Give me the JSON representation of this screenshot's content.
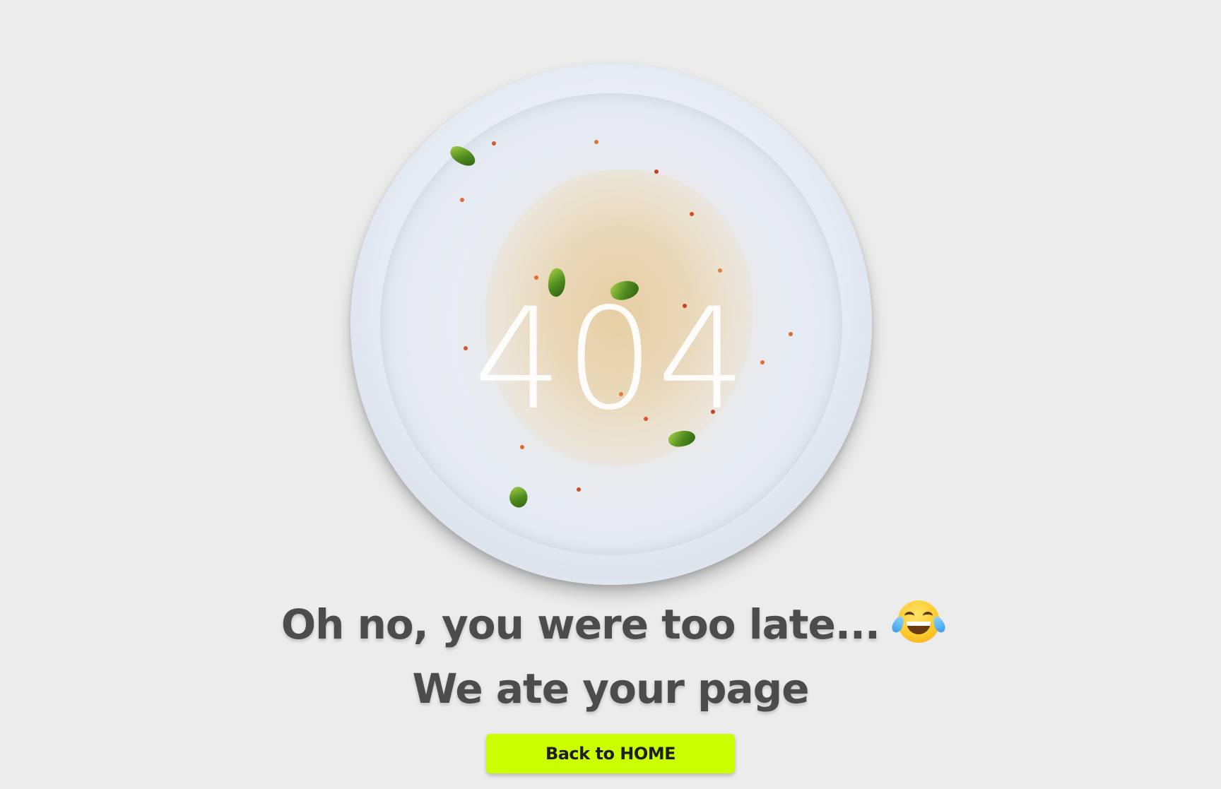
{
  "plate": {
    "error_code": "404",
    "image_name": "empty-dirty-plate"
  },
  "message": {
    "line1": "Oh no, you were too late...",
    "emoji_name": "face-with-tears-of-joy-icon",
    "line2": "We ate your page"
  },
  "button": {
    "label": "Back to HOME"
  },
  "colors": {
    "background": "#ececec",
    "text": "#4c4c4c",
    "button": "#cbff00"
  }
}
